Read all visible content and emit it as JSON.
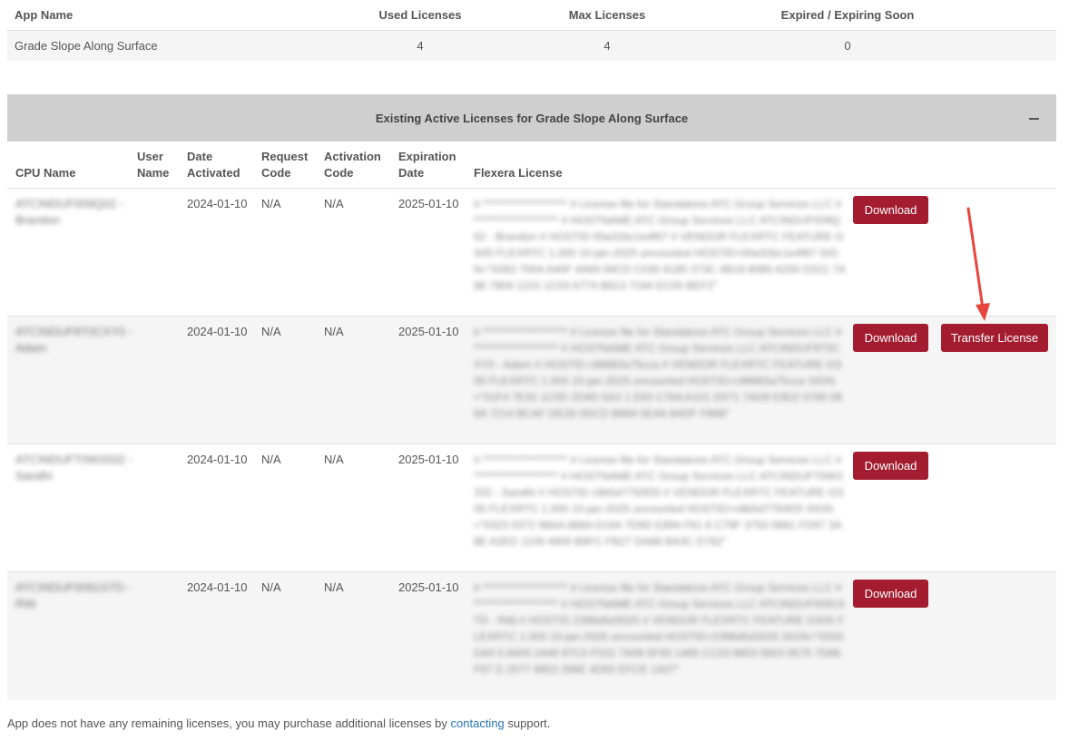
{
  "summary": {
    "headers": {
      "app": "App Name",
      "used": "Used Licenses",
      "max": "Max Licenses",
      "expired": "Expired / Expiring Soon"
    },
    "row": {
      "app": "Grade Slope Along Surface",
      "used": "4",
      "max": "4",
      "expired": "0"
    }
  },
  "panel": {
    "title": "Existing Active Licenses for Grade Slope Along Surface",
    "collapse_icon": "minus-icon"
  },
  "licenses": {
    "headers": {
      "cpu": "CPU Name",
      "user_1": "User",
      "user_2": "Name",
      "date_1": "Date",
      "date_2": "Activated",
      "req_1": "Request",
      "req_2": "Code",
      "act_1": "Activation",
      "act_2": "Code",
      "exp_1": "Expiration",
      "exp_2": "Date",
      "flex": "Flexera License"
    },
    "download_label": "Download",
    "transfer_label": "Transfer License",
    "rows": [
      {
        "cpu": "ATCINDUF009Q02 - Brandon",
        "date": "2024-01-10",
        "request": "N/A",
        "activation": "N/A",
        "expiration": "2025-01-10",
        "flexera": "# ******************** # License file for Standalone ATC Group Services LLC # ******************** # HOSTNAME ATC Group Services LLC ATCINDUF009Q02 - Brandon # HOSTID 00a32bc1e4f67 # VENDOR FLEXRTC FEATURE GS05 FLEXRTC 1.000 10-jan-2025 uncounted HOSTID=00a32bc1e4f67 SIGN=\"0283 7004 A40F 4A69 94CD C030 8185 373C 4B19 8085 A200 D321 7A98 7909 1215 1C03 A774 B813 7194 EC00 BEF2\""
      },
      {
        "cpu": "ATCINDUF8T0CXY0 - Adam",
        "date": "2024-01-10",
        "request": "N/A",
        "activation": "N/A",
        "expiration": "2025-01-10",
        "flexera": "# ******************** # License file for Standalone ATC Group Services LLC # ******************** # HOSTNAME ATC Group Services LLC ATCINDUF8T0CXY0 - Adam # HOSTID c98883a75cca # VENDOR FLEXRTC FEATURE GS05 FLEXRTC 1.000 10-jan-2025 uncounted HOSTID=c98883a75cca SIGN=\"01F4 7E32 1C0D 2D4D 5A3 1 E93 C78A A101 D071 7AD9 E9D2 5785 088A 7214 BCAF DE28 0DCD B684 5E4A 8ADF F86B\""
      },
      {
        "cpu": "ATCINDUFT0W3332 - Sandhi",
        "date": "2024-01-10",
        "request": "N/A",
        "activation": "N/A",
        "expiration": "2025-01-10",
        "flexera": "# ******************** # License file for Standalone ATC Group Services LLC # ******************** # HOSTNAME ATC Group Services LLC ATCINDUFT0W3332 - Sandhi # HOSTID c8b5d7750f20 # VENDOR FLEXRTC FEATURE GS05 FLEXRTC 1.000 10-jan-2025 uncounted HOSTID=c8b5d7750f20 SIGN=\"0323 0372 98AA 888A D194 7D9D E894 F61 6 C79F 3750 0681 FD97 3A8E A2ED 1109 4900 B8FC FB27 DA88 BA3C D782\""
      },
      {
        "cpu": "ATCINDUF0091STD - Ritti",
        "date": "2024-01-10",
        "request": "N/A",
        "activation": "N/A",
        "expiration": "2025-01-10",
        "flexera": "# ******************** # License file for Standalone ATC Group Services LLC # ******************** # HOSTNAME ATC Group Services LLC ATCINDUF0091STD - Ritti # HOSTID 2396d5d3025 # VENDOR FLEXRTC FEATURE GS05 FLEXRTC 1.000 10-jan-2025 uncounted HOSTID=2396d5d3025 SIGN=\"0333 DA0 5 8400 2448 97C0 F022 7A09 5F83 1465 CC03 8803 5603 9575 7D86 F87 D 2077 8853 286E 4D93 EFCE 1A07\""
      }
    ]
  },
  "footer": {
    "text_before": "App does not have any remaining licenses, you may purchase additional licenses by ",
    "link": "contacting",
    "text_after": " support."
  },
  "colors": {
    "accent": "#a31c30",
    "panel_header": "#cfcfcf",
    "link": "#2a76b5",
    "annotation_arrow": "#e8453c"
  }
}
